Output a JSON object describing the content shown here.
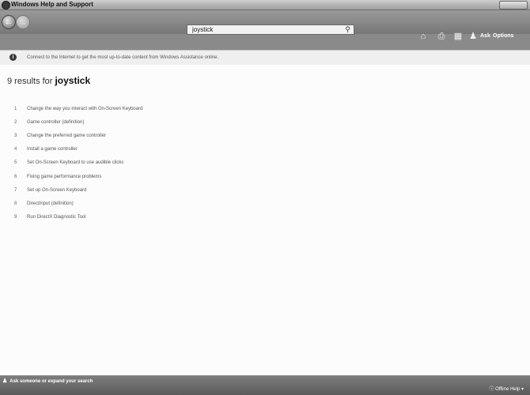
{
  "window": {
    "title": "Windows Help and Support"
  },
  "toolbar": {
    "search_value": "joystick",
    "ask_label": "Ask",
    "options_label": "Options"
  },
  "infobar": {
    "message": "Connect to the Internet to get the most up-to-date content from Windows Assistance online."
  },
  "results": {
    "count_text": "9 results for",
    "query": "joystick",
    "items": [
      {
        "num": "1",
        "label": "Change the way you interact with On-Screen Keyboard"
      },
      {
        "num": "2",
        "label": "Game controller (definition)"
      },
      {
        "num": "3",
        "label": "Change the preferred game controller"
      },
      {
        "num": "4",
        "label": "Install a game controller"
      },
      {
        "num": "5",
        "label": "Set On-Screen Keyboard to use audible clicks"
      },
      {
        "num": "6",
        "label": "Fixing game performance problems"
      },
      {
        "num": "7",
        "label": "Set up On-Screen Keyboard"
      },
      {
        "num": "8",
        "label": "DirectInput (definition)"
      },
      {
        "num": "9",
        "label": "Run DirectX Diagnostic Tool"
      }
    ]
  },
  "bottom": {
    "ask_text": "Ask someone or expand your search",
    "offline_help": "Offline Help"
  },
  "icons": {
    "back": "back-arrow-icon",
    "forward": "forward-arrow-icon",
    "search": "search-icon",
    "home": "home-icon",
    "print": "print-icon",
    "browse": "browse-help-icon",
    "ask": "ask-person-icon",
    "info": "info-icon"
  }
}
